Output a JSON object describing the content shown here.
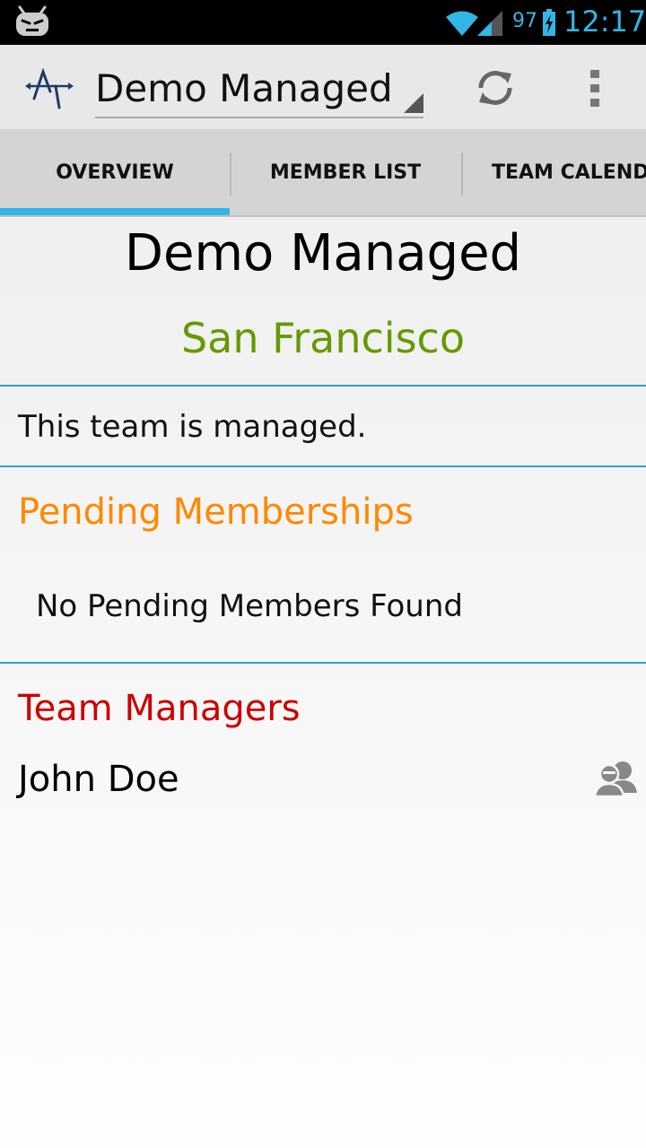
{
  "status_bar": {
    "battery_percent": "97",
    "time": "12:17",
    "icons": [
      "android-bot-icon",
      "wifi-icon",
      "cell-signal-icon",
      "battery-charging-icon"
    ]
  },
  "action_bar": {
    "title": "Demo Managed",
    "icons": [
      "app-logo-icon",
      "spinner-arrow-icon",
      "refresh-icon",
      "overflow-menu-icon"
    ]
  },
  "tabs": [
    {
      "label": "OVERVIEW",
      "selected": true
    },
    {
      "label": "MEMBER LIST",
      "selected": false
    },
    {
      "label": "TEAM CALENDAR",
      "selected": false
    }
  ],
  "overview": {
    "team_name": "Demo Managed",
    "location": "San Francisco",
    "managed_text": "This team is managed.",
    "pending_heading": "Pending Memberships",
    "pending_empty": "No Pending Members Found",
    "managers_heading": "Team Managers",
    "managers": [
      {
        "name": "John Doe",
        "icon": "group-icon"
      }
    ]
  },
  "colors": {
    "accent": "#33b5e5",
    "location": "#669900",
    "pending": "#ff8800",
    "managers": "#cc0000"
  }
}
